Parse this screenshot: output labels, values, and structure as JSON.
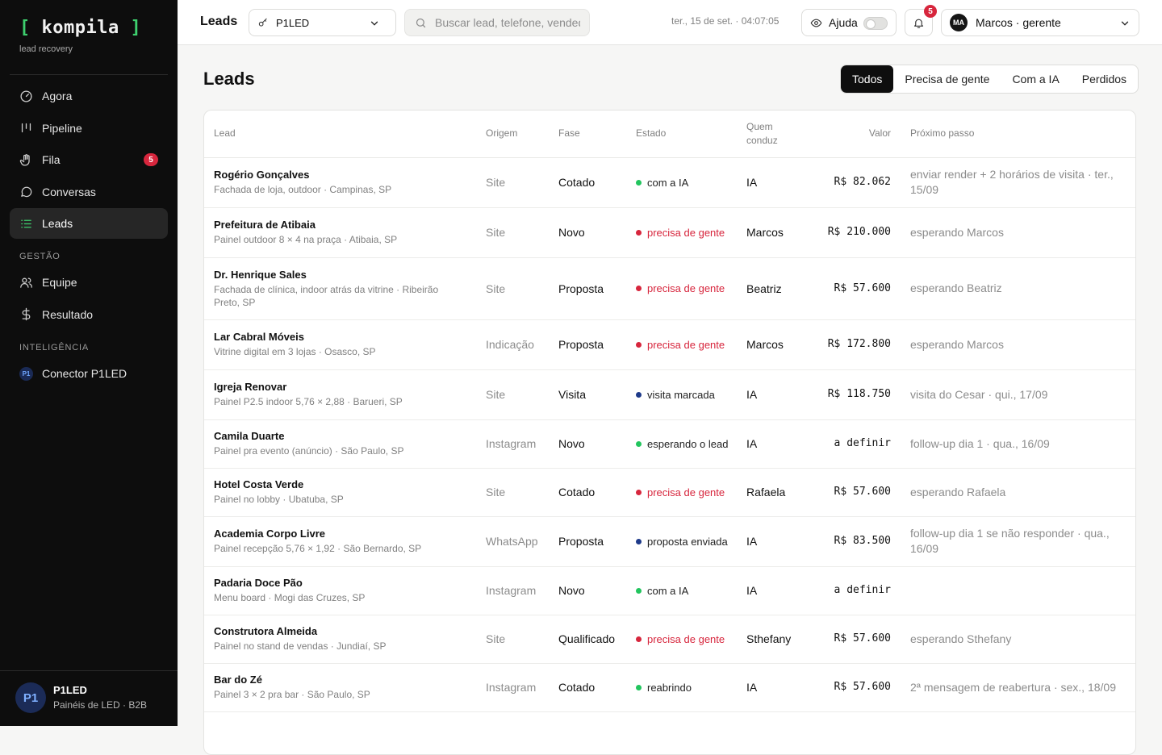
{
  "app": {
    "brand_open": "[",
    "brand_name": "kompila",
    "brand_close": "]",
    "brand_sub": "lead recovery"
  },
  "sidebar": {
    "items": [
      {
        "label": "Agora",
        "icon": "gauge-icon"
      },
      {
        "label": "Pipeline",
        "icon": "pipeline-icon"
      },
      {
        "label": "Fila",
        "icon": "hand-icon",
        "badge": "5"
      },
      {
        "label": "Conversas",
        "icon": "chat-bubble-icon"
      },
      {
        "label": "Leads",
        "icon": "list-icon",
        "active": true
      }
    ],
    "section_gestao": "GESTÃO",
    "gestao_items": [
      {
        "label": "Equipe",
        "icon": "users-icon"
      },
      {
        "label": "Resultado",
        "icon": "dollar-icon"
      }
    ],
    "section_inteligencia": "INTELIGÊNCIA",
    "inteligencia_items": [
      {
        "label": "Conector P1LED",
        "icon_text": "P1"
      }
    ],
    "org": {
      "logo": "P1",
      "name": "P1LED",
      "desc": "Painéis de LED · B2B"
    }
  },
  "topbar": {
    "title": "Leads",
    "tenant": "P1LED",
    "search_placeholder": "Buscar lead, telefone, vendedor",
    "datetime": "ter., 15 de set. · 04:07:05",
    "help_label": "Ajuda",
    "notifications": "5",
    "user_initials": "MA",
    "user_label": "Marcos · gerente"
  },
  "main": {
    "title": "Leads",
    "filters": [
      "Todos",
      "Precisa de gente",
      "Com a IA",
      "Perdidos"
    ],
    "active_filter": "Todos"
  },
  "colors": {
    "green": "#22c55e",
    "red": "#d7263d",
    "blue": "#1e3a8a",
    "accent_brand": "#3ecf6e"
  },
  "table": {
    "headers": {
      "lead": "Lead",
      "origem": "Origem",
      "fase": "Fase",
      "estado": "Estado",
      "quem": "Quem conduz",
      "valor": "Valor",
      "proximo": "Próximo passo"
    },
    "rows": [
      {
        "name": "Rogério Gonçalves",
        "desc": "Fachada de loja, outdoor · Campinas, SP",
        "origem": "Site",
        "fase": "Cotado",
        "estado": "com a IA",
        "estado_color": "green",
        "quem": "IA",
        "valor": "R$ 82.062",
        "proximo": "enviar render + 2 horários de visita · ter., 15/09"
      },
      {
        "name": "Prefeitura de Atibaia",
        "desc": "Painel outdoor 8 × 4 na praça · Atibaia, SP",
        "origem": "Site",
        "fase": "Novo",
        "estado": "precisa de gente",
        "estado_color": "red",
        "quem": "Marcos",
        "valor": "R$ 210.000",
        "proximo": "esperando Marcos"
      },
      {
        "name": "Dr. Henrique Sales",
        "desc": "Fachada de clínica, indoor atrás da vitrine · Ribeirão Preto, SP",
        "origem": "Site",
        "fase": "Proposta",
        "estado": "precisa de gente",
        "estado_color": "red",
        "quem": "Beatriz",
        "valor": "R$ 57.600",
        "proximo": "esperando Beatriz"
      },
      {
        "name": "Lar Cabral Móveis",
        "desc": "Vitrine digital em 3 lojas · Osasco, SP",
        "origem": "Indicação",
        "fase": "Proposta",
        "estado": "precisa de gente",
        "estado_color": "red",
        "quem": "Marcos",
        "valor": "R$ 172.800",
        "proximo": "esperando Marcos"
      },
      {
        "name": "Igreja Renovar",
        "desc": "Painel P2.5 indoor 5,76 × 2,88 · Barueri, SP",
        "origem": "Site",
        "fase": "Visita",
        "estado": "visita marcada",
        "estado_color": "blue",
        "quem": "IA",
        "valor": "R$ 118.750",
        "proximo": "visita do Cesar · qui., 17/09"
      },
      {
        "name": "Camila Duarte",
        "desc": "Painel pra evento (anúncio) · São Paulo, SP",
        "origem": "Instagram",
        "fase": "Novo",
        "estado": "esperando o lead",
        "estado_color": "green",
        "quem": "IA",
        "valor": "a definir",
        "proximo": "follow-up dia 1 · qua., 16/09"
      },
      {
        "name": "Hotel Costa Verde",
        "desc": "Painel no lobby · Ubatuba, SP",
        "origem": "Site",
        "fase": "Cotado",
        "estado": "precisa de gente",
        "estado_color": "red",
        "quem": "Rafaela",
        "valor": "R$ 57.600",
        "proximo": "esperando Rafaela"
      },
      {
        "name": "Academia Corpo Livre",
        "desc": "Painel recepção 5,76 × 1,92 · São Bernardo, SP",
        "origem": "WhatsApp",
        "fase": "Proposta",
        "estado": "proposta enviada",
        "estado_color": "blue",
        "quem": "IA",
        "valor": "R$ 83.500",
        "proximo": "follow-up dia 1 se não responder · qua., 16/09"
      },
      {
        "name": "Padaria Doce Pão",
        "desc": "Menu board · Mogi das Cruzes, SP",
        "origem": "Instagram",
        "fase": "Novo",
        "estado": "com a IA",
        "estado_color": "green",
        "quem": "IA",
        "valor": "a definir",
        "proximo": ""
      },
      {
        "name": "Construtora Almeida",
        "desc": "Painel no stand de vendas · Jundiaí, SP",
        "origem": "Site",
        "fase": "Qualificado",
        "estado": "precisa de gente",
        "estado_color": "red",
        "quem": "Sthefany",
        "valor": "R$ 57.600",
        "proximo": "esperando Sthefany"
      },
      {
        "name": "Bar do Zé",
        "desc": "Painel 3 × 2 pra bar · São Paulo, SP",
        "origem": "Instagram",
        "fase": "Cotado",
        "estado": "reabrindo",
        "estado_color": "green",
        "quem": "IA",
        "valor": "R$ 57.600",
        "proximo": "2ª mensagem de reabertura · sex., 18/09"
      }
    ]
  }
}
